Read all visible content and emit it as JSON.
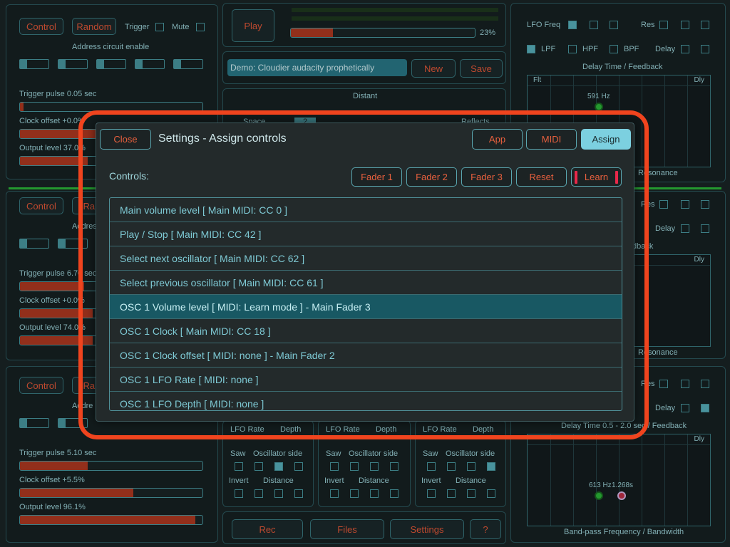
{
  "background": {
    "top_left": {
      "control": "Control",
      "random": "Random",
      "trigger": "Trigger",
      "mute": "Mute",
      "address_title": "Address circuit enable",
      "addr_values": [
        "1",
        "1",
        "1",
        "1",
        "1"
      ],
      "trigger_pulse": "Trigger pulse 0.05 sec",
      "clock_offset": "Clock offset +0.0%",
      "output_level": "Output level 37.0%",
      "trigger_fill": 0.02,
      "clock_fill": 0.5,
      "output_fill": 0.37
    },
    "mid_left": {
      "control": "Control",
      "random": "Rand",
      "address_title": "Addres",
      "addr_values": [
        "1",
        "1"
      ],
      "trigger_pulse": "Trigger pulse 6.70 sec",
      "clock_offset": "Clock offset +0.0%",
      "output_level": "Output level 74.0%",
      "trigger_fill": 0.35,
      "clock_fill": 0.4,
      "output_fill": 0.4
    },
    "bot_left": {
      "control": "Control",
      "random": "Rand",
      "address_title": "Addre",
      "addr_values": [
        "1",
        "1"
      ],
      "trigger_pulse": "Trigger pulse 5.10 sec",
      "clock_offset": "Clock offset +5.5%",
      "output_level": "Output level 96.1%",
      "trigger_fill": 0.37,
      "clock_fill": 0.62,
      "output_fill": 0.96
    },
    "transport": {
      "play": "Play",
      "progress_pct": "23%",
      "progress_fill": 0.23,
      "demo_name": "Demo: Cloudier audacity prophetically",
      "new": "New",
      "save": "Save",
      "distant": "Distant",
      "space": "Space",
      "space_value": "2",
      "reflects": "Reflects"
    },
    "right": {
      "lfo_freq": "LFO Freq",
      "res": "Res",
      "lpf": "LPF",
      "hpf": "HPF",
      "bpf": "BPF",
      "delay": "Delay",
      "graph_title": "Delay Time / Feedback",
      "flt": "Flt",
      "dly": "Dly",
      "hz_label": "591 Hz",
      "resonance": "Resonance",
      "mid_res": "Res",
      "mid_delay": "Delay",
      "mid_dback": "dback",
      "mid_dly": "Dly",
      "mid_resonance": "Resonance",
      "bot_res": "Res",
      "bot_delay": "Delay",
      "bot_title": "Delay Time 0.5 - 2.0 sec / Feedback",
      "bot_dly": "Dly",
      "bot_hz": "613 Hz",
      "bot_s": "1.268s",
      "bot_bottom": "Band-pass Frequency / Bandwidth"
    },
    "osc_cols": [
      {
        "lfo_rate": "LFO Rate",
        "depth": "Depth",
        "saw": "Saw",
        "osc_side": "Oscillator side",
        "invert": "Invert",
        "distance": "Distance"
      },
      {
        "lfo_rate": "LFO Rate",
        "depth": "Depth",
        "saw": "Saw",
        "osc_side": "Oscillator side",
        "invert": "Invert",
        "distance": "Distance"
      },
      {
        "lfo_rate": "LFO Rate",
        "depth": "Depth",
        "saw": "Saw",
        "osc_side": "Oscillator side",
        "invert": "Invert",
        "distance": "Distance"
      }
    ],
    "bottom_bar": {
      "rec": "Rec",
      "files": "Files",
      "settings": "Settings",
      "help": "?"
    }
  },
  "dialog": {
    "close": "Close",
    "title": "Settings - Assign controls",
    "tabs": {
      "app": "App",
      "midi": "MIDI",
      "assign": "Assign"
    },
    "active_tab": "Assign",
    "controls_label": "Controls:",
    "fader1": "Fader 1",
    "fader2": "Fader 2",
    "fader3": "Fader 3",
    "reset": "Reset",
    "learn": "Learn",
    "items": [
      "Main volume level [ Main MIDI: CC 0 ]",
      "Play / Stop [ Main MIDI: CC 42 ]",
      "Select next oscillator [ Main MIDI: CC 62 ]",
      "Select previous oscillator [ Main MIDI: CC 61 ]",
      "OSC 1 Volume level [ MIDI: Learn mode ] - Main Fader 3",
      "OSC 1 Clock [ Main MIDI: CC 18 ]",
      "OSC 1 Clock offset [ MIDI: none ] - Main Fader 2",
      "OSC 1 LFO Rate [ MIDI: none ]",
      "OSC 1 LFO Depth [ MIDI: none ]"
    ],
    "selected_index": 4
  },
  "colors": {
    "accent": "#7cd0e0",
    "highlight_ring": "#f0441e",
    "button_text": "#e8603e",
    "bar_fill": "#b23a22"
  }
}
